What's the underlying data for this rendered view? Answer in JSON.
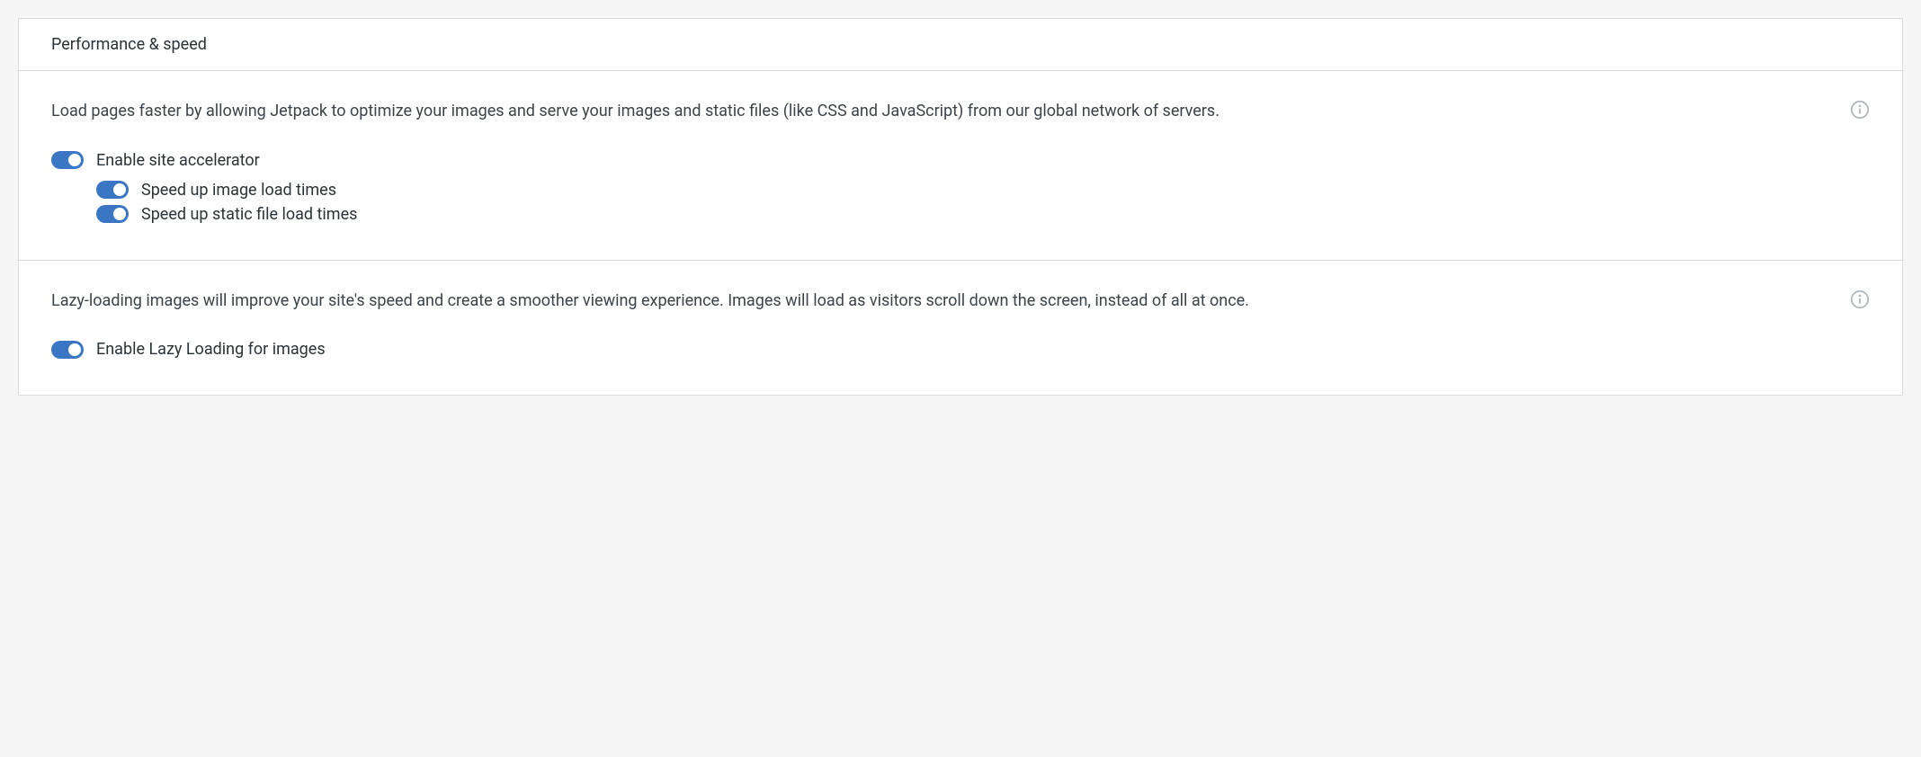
{
  "panel": {
    "title": "Performance & speed"
  },
  "accelerator": {
    "description": "Load pages faster by allowing Jetpack to optimize your images and serve your images and static files (like CSS and JavaScript) from our global network of servers.",
    "enable_label": "Enable site accelerator",
    "speed_images_label": "Speed up image load times",
    "speed_static_label": "Speed up static file load times"
  },
  "lazy": {
    "description": "Lazy-loading images will improve your site's speed and create a smoother viewing experience. Images will load as visitors scroll down the screen, instead of all at once.",
    "enable_label": "Enable Lazy Loading for images"
  },
  "colors": {
    "toggle_on": "#3a76c4"
  }
}
